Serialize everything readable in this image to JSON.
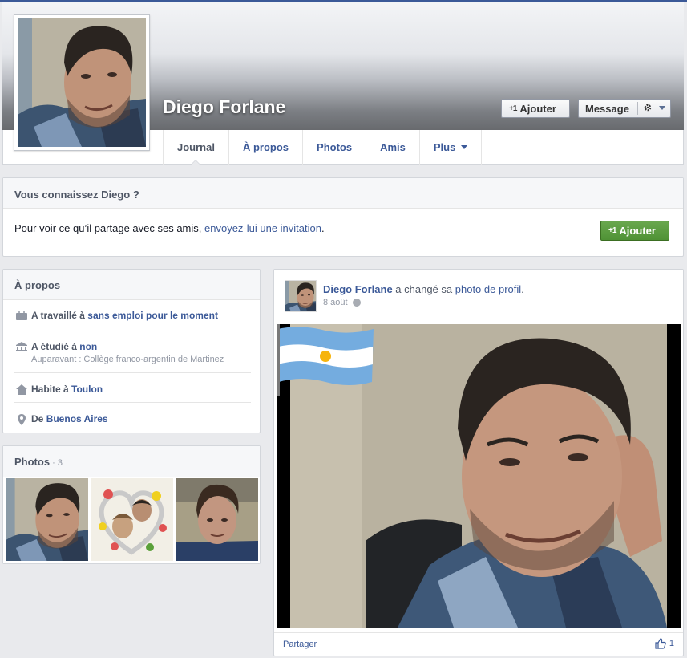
{
  "profile": {
    "name": "Diego Forlane"
  },
  "header_buttons": {
    "add_prefix": "+1",
    "add_label": "Ajouter",
    "message_label": "Message"
  },
  "tabs": [
    {
      "label": "Journal",
      "active": true
    },
    {
      "label": "À propos"
    },
    {
      "label": "Photos"
    },
    {
      "label": "Amis"
    },
    {
      "label": "Plus"
    }
  ],
  "know_box": {
    "title": "Vous connaissez Diego ?",
    "text_before": "Pour voir ce qu’il partage avec ses amis, ",
    "link_text": "envoyez-lui une invitation",
    "text_after": ".",
    "button_prefix": "+1",
    "button_label": "Ajouter",
    "button_color": "#5ca23a"
  },
  "about": {
    "title": "À propos",
    "items": [
      {
        "icon": "briefcase-icon",
        "prefix": "A travaillé à ",
        "link": "sans emploi pour le moment"
      },
      {
        "icon": "school-icon",
        "prefix": "A étudié à ",
        "link": "non",
        "sub": "Auparavant : Collège franco-argentin de Martinez"
      },
      {
        "icon": "home-icon",
        "prefix": "Habite à ",
        "link": "Toulon"
      },
      {
        "icon": "location-pin-icon",
        "prefix": "De ",
        "link": "Buenos Aires"
      }
    ]
  },
  "photos_card": {
    "title": "Photos",
    "count": " · 3"
  },
  "post": {
    "author": "Diego Forlane",
    "action": " a changé sa ",
    "action_link": "photo de profil",
    "action_end": ".",
    "date": "8 août",
    "share_label": "Partager",
    "likes_count": "1"
  },
  "colors": {
    "link": "#3b5998",
    "accent_green": "#5ca23a",
    "background": "#e9eaed"
  }
}
